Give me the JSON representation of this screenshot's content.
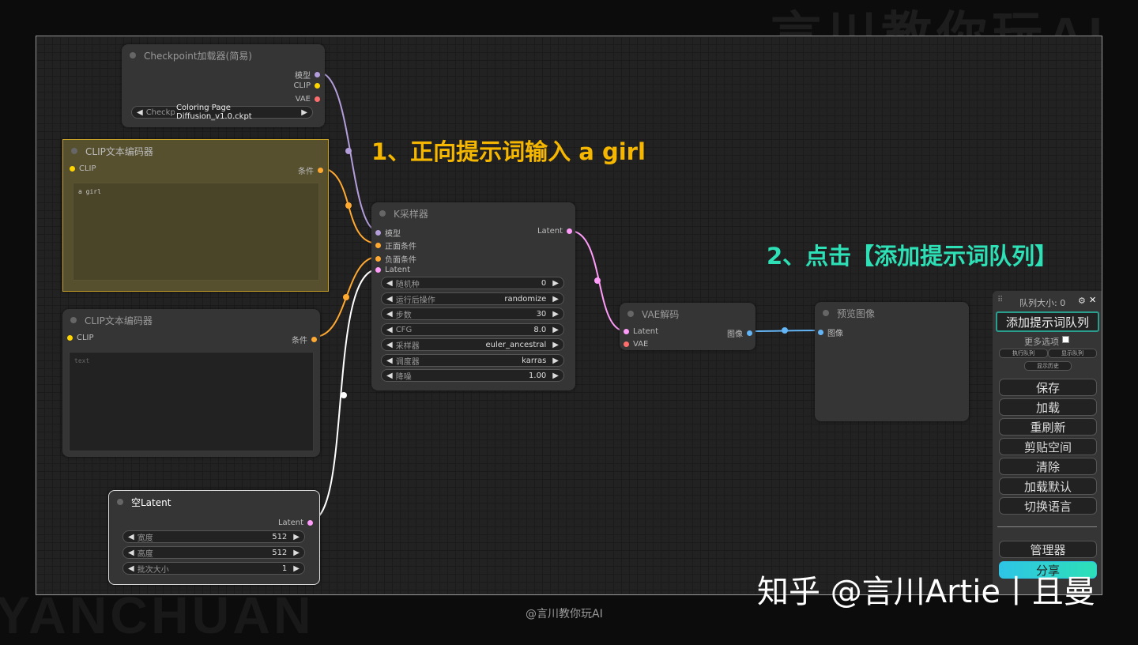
{
  "watermarks": {
    "top": "言川教你玩AI",
    "bottom": "YANCHUAN"
  },
  "nodes": {
    "checkpoint": {
      "title": "Checkpoint加载器(简易)",
      "out_model": "模型",
      "out_clip": "CLIP",
      "out_vae": "VAE",
      "ckpt_label": "Checkpoint...",
      "ckpt_value": "Coloring Page Diffusion_v1.0.ckpt"
    },
    "clip_pos": {
      "title": "CLIP文本编码器",
      "in_clip": "CLIP",
      "out_cond": "条件",
      "text": "a girl"
    },
    "clip_neg": {
      "title": "CLIP文本编码器",
      "in_clip": "CLIP",
      "out_cond": "条件",
      "text": "text"
    },
    "latent": {
      "title": "空Latent",
      "out_latent": "Latent",
      "widgets": [
        {
          "label": "宽度",
          "value": "512"
        },
        {
          "label": "高度",
          "value": "512"
        },
        {
          "label": "批次大小",
          "value": "1"
        }
      ]
    },
    "ksampler": {
      "title": "K采样器",
      "in_model": "模型",
      "in_pos": "正面条件",
      "in_neg": "负面条件",
      "in_latent": "Latent",
      "out_latent": "Latent",
      "widgets": [
        {
          "label": "随机种",
          "value": "0"
        },
        {
          "label": "运行后操作",
          "value": "randomize"
        },
        {
          "label": "步数",
          "value": "30"
        },
        {
          "label": "CFG",
          "value": "8.0"
        },
        {
          "label": "采样器",
          "value": "euler_ancestral"
        },
        {
          "label": "调度器",
          "value": "karras"
        },
        {
          "label": "降噪",
          "value": "1.00"
        }
      ]
    },
    "vae": {
      "title": "VAE解码",
      "in_latent": "Latent",
      "in_vae": "VAE",
      "out_image": "图像"
    },
    "preview": {
      "title": "预览图像",
      "in_image": "图像"
    }
  },
  "annotations": {
    "step1": "1、正向提示词输入 a girl",
    "step2": "2、点击【添加提示词队列】"
  },
  "queue_panel": {
    "queue_size": "队列大小: 0",
    "add_queue": "添加提示词队列",
    "more_options": "更多选项",
    "run_queue": "执行队列",
    "show_queue": "显示队列",
    "show_history": "显示历史",
    "buttons": [
      "保存",
      "加载",
      "重刷新",
      "剪贴空间",
      "清除",
      "加载默认",
      "切换语言"
    ],
    "manager": "管理器",
    "share": "分享"
  },
  "credit": "知乎 @言川Artie丨且曼",
  "footer": "@言川教你玩AI",
  "colors": {
    "model": "#b39ddb",
    "clip": "#ffd500",
    "vae": "#ff6e6e",
    "cond": "#ffa931",
    "latent": "#ff9cf9",
    "image": "#64b5f6",
    "accent_yellow": "#f5b700",
    "accent_teal": "#2de0b6"
  }
}
